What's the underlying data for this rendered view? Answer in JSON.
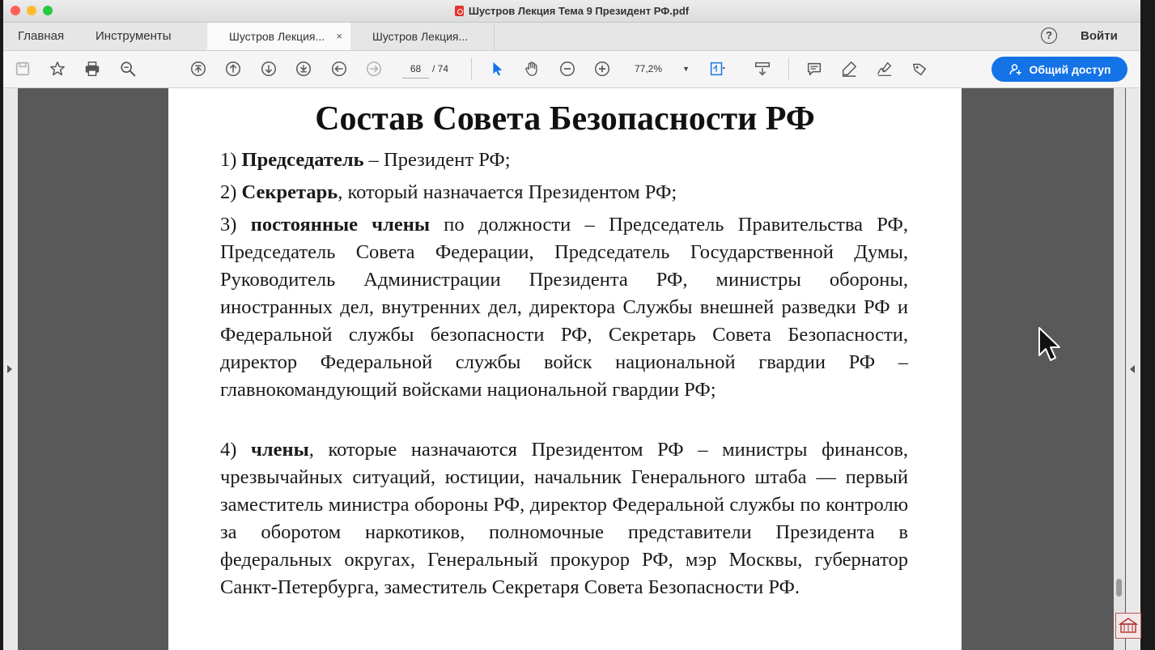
{
  "window": {
    "title": "Шустров Лекция Тема 9 Президент РФ.pdf"
  },
  "nav": {
    "home": "Главная",
    "tools": "Инструменты"
  },
  "tabs": [
    {
      "label": "Шустров Лекция...",
      "close": "×"
    },
    {
      "label": "Шустров Лекция..."
    }
  ],
  "header": {
    "help": "?",
    "login": "Войти"
  },
  "toolbar": {
    "page_current": "68",
    "page_total": "/ 74",
    "zoom": "77,2%",
    "share_label": "Общий доступ"
  },
  "document": {
    "heading": "Состав Совета Безопасности РФ",
    "items": [
      {
        "num": "1)",
        "bold": "Председатель",
        "rest": " – Президент РФ;"
      },
      {
        "num": "2)",
        "bold": "Секретарь",
        "rest": ", который назначается Президентом РФ;"
      },
      {
        "num": "3)",
        "bold": "постоянные члены",
        "rest": " по должности – Председатель Правительства РФ, Председатель Совета Федерации, Председатель Государственной Думы, Руководитель Администрации Президента РФ, министры обороны, иностранных дел, внутренних дел, директора Службы внешней разведки РФ и Федеральной службы безопасности РФ, Секретарь Совета Безопасности, директор Федеральной службы войск национальной гвардии РФ – главнокомандующий войсками национальной гвардии РФ;"
      },
      {
        "num": "4)",
        "bold": "члены",
        "rest": ", которые назначаются Президентом РФ – министры финансов, чрезвычайных ситуаций, юстиции, начальник Генерального штаба — первый заместитель министра обороны РФ, директор Федеральной службы по контролю за оборотом наркотиков, полномочные представители Президента в федеральных округах, Генеральный прокурор РФ, мэр Москвы, губернатор Санкт-Петербурга, заместитель Секретаря Совета Безопасности РФ."
      }
    ]
  },
  "colors": {
    "accent": "#1473e6",
    "page_bg": "#ffffff",
    "viewer_bg": "#595959"
  },
  "icons": [
    "save-icon",
    "bookmark-star-icon",
    "print-icon",
    "search-zoom-icon",
    "first-page-icon",
    "prev-page-icon",
    "next-page-icon",
    "last-page-icon",
    "back-icon",
    "forward-icon",
    "select-cursor-icon",
    "hand-tool-icon",
    "zoom-out-icon",
    "zoom-in-icon",
    "fit-page-icon",
    "scroll-mode-icon",
    "comment-icon",
    "highlight-icon",
    "sign-icon",
    "stamp-icon",
    "share-user-icon"
  ]
}
